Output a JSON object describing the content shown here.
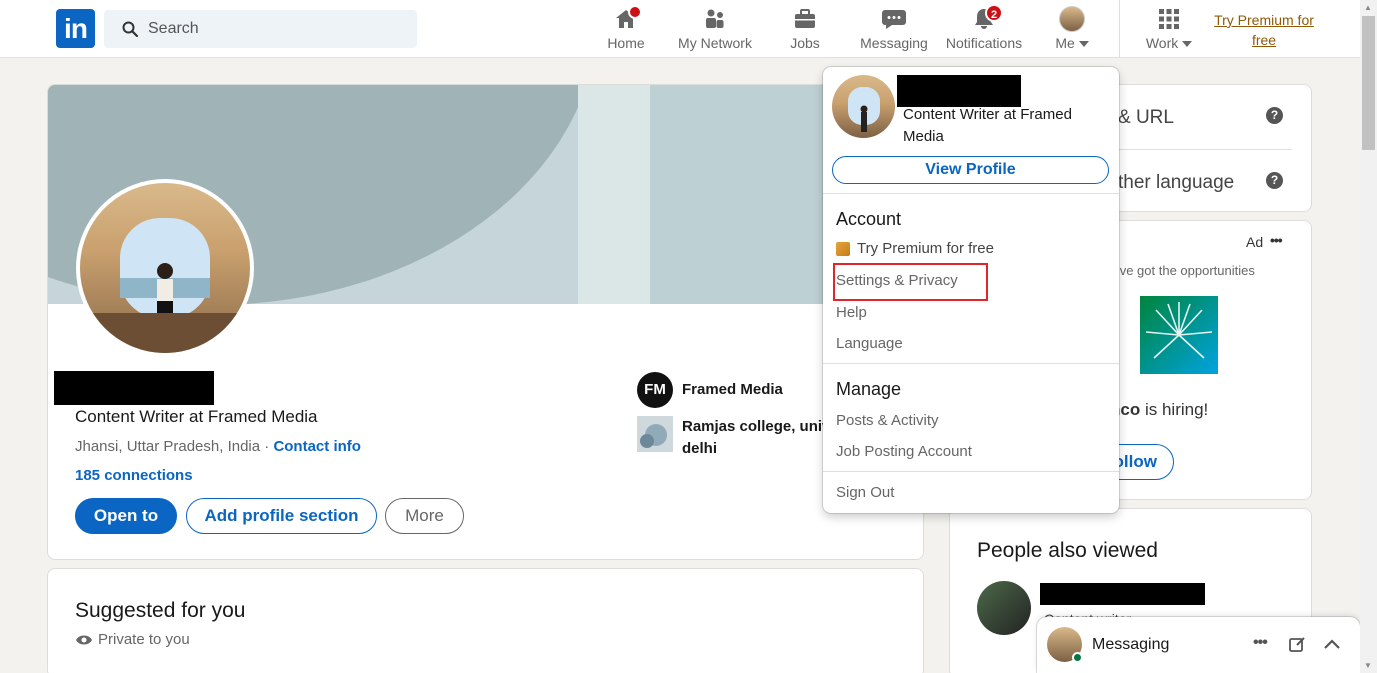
{
  "nav": {
    "search_placeholder": "Search",
    "items": [
      {
        "label": "Home",
        "badge": ""
      },
      {
        "label": "My Network",
        "badge": ""
      },
      {
        "label": "Jobs",
        "badge": ""
      },
      {
        "label": "Messaging",
        "badge": ""
      },
      {
        "label": "Notifications",
        "badge": "2"
      },
      {
        "label": "Me",
        "badge": ""
      },
      {
        "label": "Work",
        "badge": ""
      }
    ],
    "premium_line1": "Try Premium for",
    "premium_line2": "free"
  },
  "profile": {
    "headline": "Content Writer at Framed Media",
    "location": "Jhansi, Uttar Pradesh, India · ",
    "contact_info": "Contact info",
    "connections": "185 connections",
    "btn_open": "Open to",
    "btn_add": "Add profile section",
    "btn_more": "More",
    "company": "Framed Media",
    "company_logo": "FM",
    "college_line1": "Ramjas college, univ",
    "college_line2": "delhi"
  },
  "suggested": {
    "title": "Suggested for you",
    "sub": "Private to you"
  },
  "right": {
    "row1": "& URL",
    "row2": "ther language",
    "ad_label": "Ad",
    "ad_more": "•••",
    "ad_text": "e've got the opportunities",
    "hiring_pre": "nco",
    "hiring_post": " is hiring!",
    "follow": "ollow",
    "people_title": "People also viewed",
    "people_sub": "Content writer"
  },
  "dropdown": {
    "headline": "Content Writer at Framed Media",
    "view_profile": "View Profile",
    "account_title": "Account",
    "try_premium": "Try Premium for free",
    "settings": "Settings & Privacy",
    "help": "Help",
    "language": "Language",
    "manage_title": "Manage",
    "posts": "Posts & Activity",
    "job_posting": "Job Posting Account",
    "sign_out": "Sign Out"
  },
  "messaging": {
    "title": "Messaging"
  },
  "colors": {
    "brand": "#0a66c2",
    "premium": "#915907",
    "badge": "#cc1016",
    "highlight": "#e0262d"
  }
}
